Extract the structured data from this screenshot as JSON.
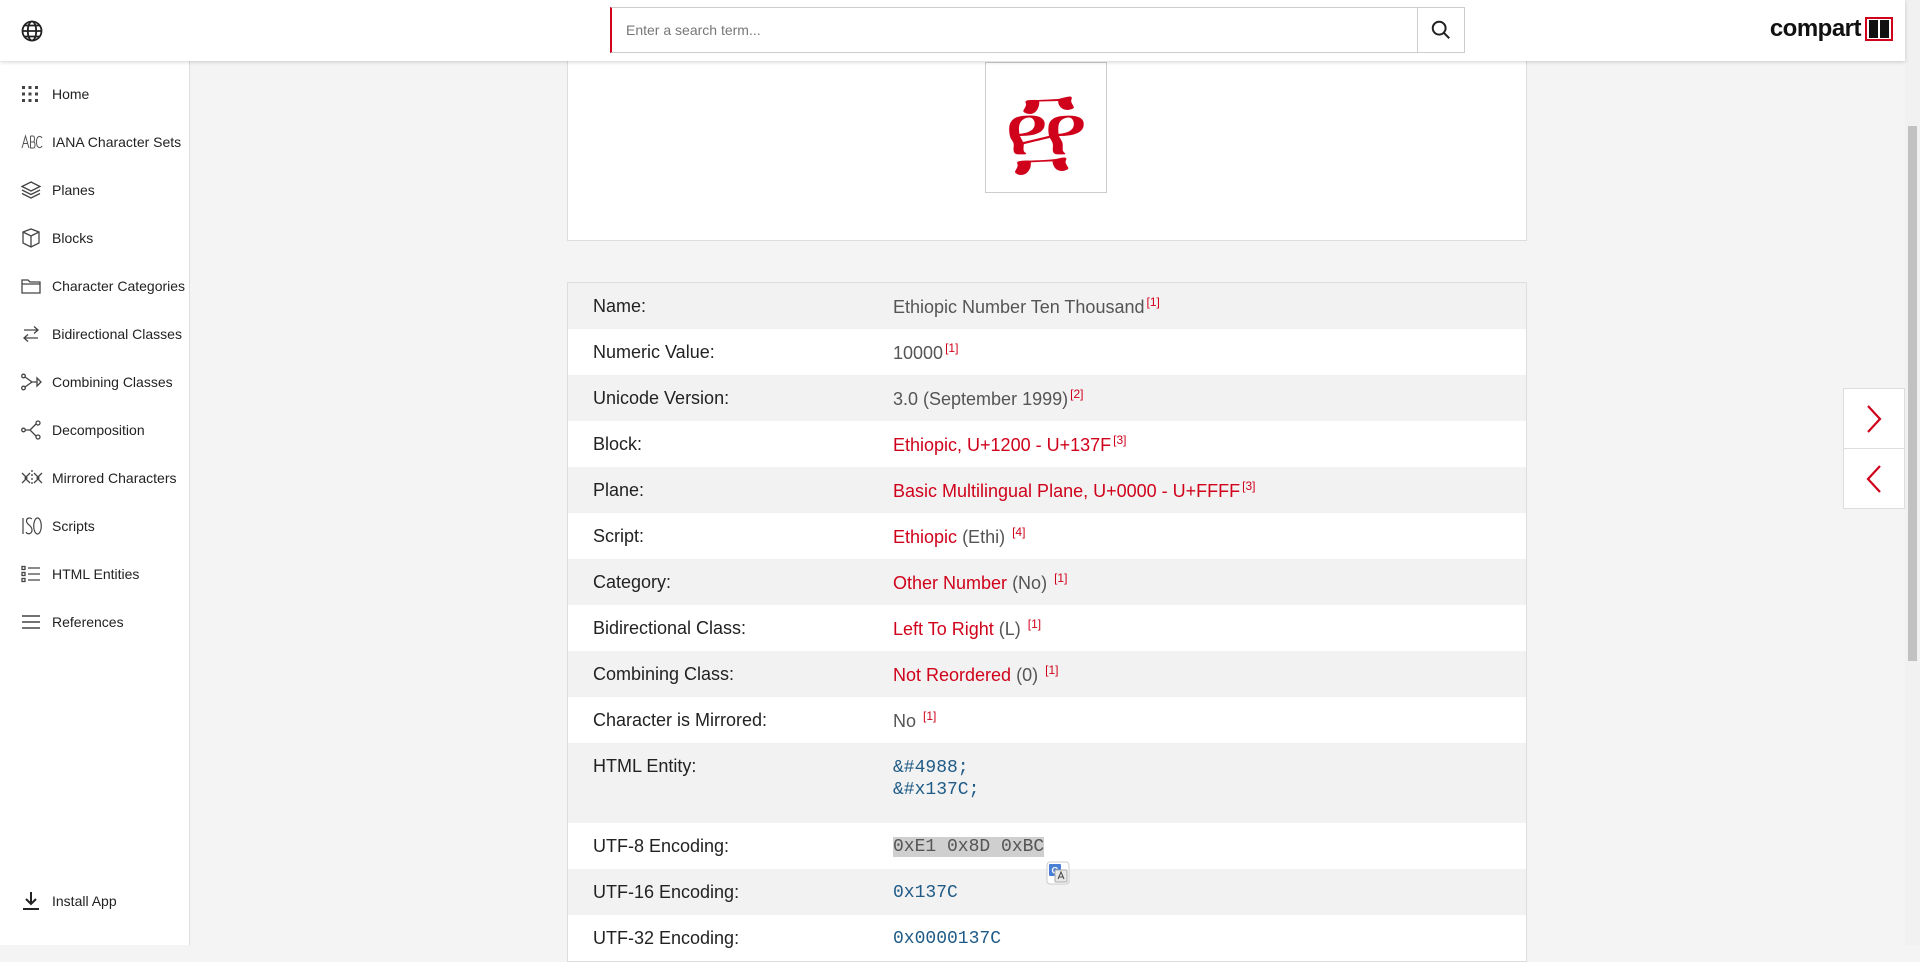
{
  "header": {
    "search_placeholder": "Enter a search term...",
    "logo_text": "compart"
  },
  "sidebar": {
    "items": [
      {
        "label": "Home",
        "icon": "grid-icon"
      },
      {
        "label": "IANA Character Sets",
        "icon": "abc-icon"
      },
      {
        "label": "Planes",
        "icon": "layers-icon"
      },
      {
        "label": "Blocks",
        "icon": "block-icon"
      },
      {
        "label": "Character Categories",
        "icon": "folder-icon"
      },
      {
        "label": "Bidirectional Classes",
        "icon": "bidi-icon"
      },
      {
        "label": "Combining Classes",
        "icon": "combining-icon"
      },
      {
        "label": "Decomposition",
        "icon": "decomposition-icon"
      },
      {
        "label": "Mirrored Characters",
        "icon": "mirror-icon"
      },
      {
        "label": "Scripts",
        "icon": "iso-icon"
      },
      {
        "label": "HTML Entities",
        "icon": "list-icon"
      },
      {
        "label": "References",
        "icon": "menu-icon"
      }
    ],
    "install_label": "Install App"
  },
  "glyph": {
    "char": "፼",
    "color": "#d0021b"
  },
  "properties": {
    "name": {
      "label": "Name:",
      "value": "Ethiopic Number Ten Thousand",
      "ref": "[1]"
    },
    "numeric": {
      "label": "Numeric Value:",
      "value": "10000",
      "ref": "[1]"
    },
    "version": {
      "label": "Unicode Version:",
      "value": "3.0 (September 1999)",
      "ref": "[2]"
    },
    "block": {
      "label": "Block:",
      "value": "Ethiopic, U+1200 - U+137F",
      "ref": "[3]"
    },
    "plane": {
      "label": "Plane:",
      "value": "Basic Multilingual Plane, U+0000 - U+FFFF",
      "ref": "[3]"
    },
    "script": {
      "label": "Script:",
      "link": "Ethiopic",
      "suffix": "(Ethi)",
      "ref": "[4]"
    },
    "category": {
      "label": "Category:",
      "link": "Other Number",
      "suffix": "(No)",
      "ref": "[1]"
    },
    "bidi": {
      "label": "Bidirectional Class:",
      "link": "Left To Right",
      "suffix": "(L)",
      "ref": "[1]"
    },
    "combining": {
      "label": "Combining Class:",
      "link": "Not Reordered",
      "suffix": "(0)",
      "ref": "[1]"
    },
    "mirrored": {
      "label": "Character is Mirrored:",
      "value": "No",
      "ref": "[1]"
    },
    "html_entity": {
      "label": "HTML Entity:",
      "dec": "&#4988;",
      "hex": "&#x137C;"
    },
    "utf8": {
      "label": "UTF-8 Encoding:",
      "value": "0xE1 0x8D 0xBC"
    },
    "utf16": {
      "label": "UTF-16 Encoding:",
      "value": "0x137C"
    },
    "utf32": {
      "label": "UTF-32 Encoding:",
      "value": "0x0000137C"
    }
  },
  "colors": {
    "accent": "#d0021b",
    "code_blue": "#1f5b86"
  }
}
